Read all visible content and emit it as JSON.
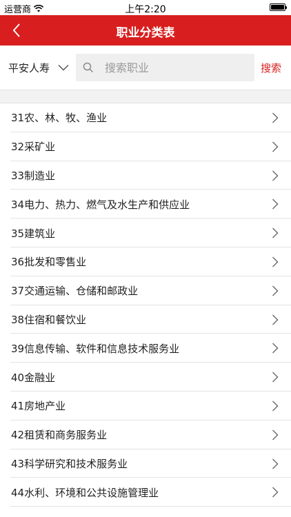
{
  "status_bar": {
    "carrier": "运营商",
    "time": "上午2:20"
  },
  "nav": {
    "title": "职业分类表",
    "back_icon": "chevron-left-icon"
  },
  "search": {
    "company": "平安人寿",
    "placeholder": "搜索职业",
    "value": "",
    "button_label": "搜索"
  },
  "colors": {
    "accent": "#d81e1e",
    "search_bg": "#efefef",
    "divider": "#e3e3e3"
  },
  "categories": [
    {
      "label": "31农、林、牧、渔业"
    },
    {
      "label": "32采矿业"
    },
    {
      "label": "33制造业"
    },
    {
      "label": "34电力、热力、燃气及水生产和供应业"
    },
    {
      "label": "35建筑业"
    },
    {
      "label": "36批发和零售业"
    },
    {
      "label": "37交通运输、仓储和邮政业"
    },
    {
      "label": "38住宿和餐饮业"
    },
    {
      "label": "39信息传输、软件和信息技术服务业"
    },
    {
      "label": "40金融业"
    },
    {
      "label": "41房地产业"
    },
    {
      "label": "42租赁和商务服务业"
    },
    {
      "label": "43科学研究和技术服务业"
    },
    {
      "label": "44水利、环境和公共设施管理业"
    }
  ]
}
